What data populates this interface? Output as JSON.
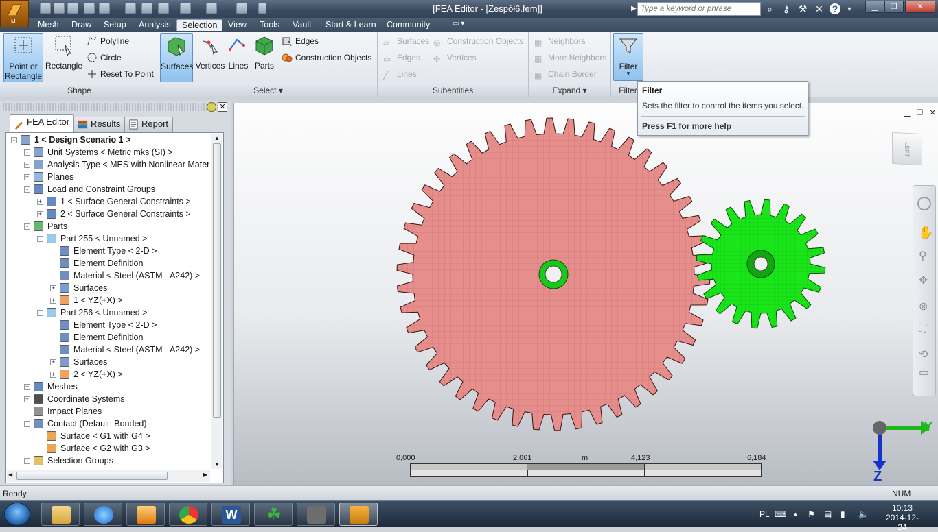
{
  "window": {
    "title": "[FEA Editor - [Zespół6.fem]]",
    "app_button_label": "M"
  },
  "search": {
    "placeholder": "Type a keyword or phrase"
  },
  "menu": [
    "Mesh",
    "Draw",
    "Setup",
    "Analysis",
    "Selection",
    "View",
    "Tools",
    "Vault",
    "Start & Learn",
    "Community"
  ],
  "menu_active": "Selection",
  "ribbon": {
    "shape": {
      "label": "Shape",
      "point_or_rectangle": "Point or Rectangle",
      "rectangle": "Rectangle",
      "polyline": "Polyline",
      "circle": "Circle",
      "reset_to_point": "Reset To Point"
    },
    "select": {
      "label": "Select",
      "surfaces": "Surfaces",
      "vertices": "Vertices",
      "lines": "Lines",
      "parts": "Parts",
      "edges": "Edges",
      "construction_objects": "Construction Objects"
    },
    "subentities": {
      "label": "Subentities",
      "surfaces": "Surfaces",
      "edges": "Edges",
      "lines": "Lines",
      "construction_objects": "Construction Objects",
      "vertices": "Vertices"
    },
    "expand": {
      "label": "Expand",
      "neighbors": "Neighbors",
      "more_neighbors": "More Neighbors",
      "chain_border": "Chain Border"
    },
    "filter": {
      "label": "Filter",
      "button": "Filter"
    }
  },
  "tooltip": {
    "title": "Filter",
    "body": "Sets the filter to control the items you select.",
    "help": "Press F1 for more help"
  },
  "panel_tabs": [
    "FEA Editor",
    "Results",
    "Report"
  ],
  "tree": [
    {
      "label": "1 < Design Scenario 1 >",
      "level": 0,
      "exp": "-",
      "bold": true,
      "icon": "scenario-icon"
    },
    {
      "label": "Unit Systems < Metric mks (SI) >",
      "level": 1,
      "exp": "+",
      "icon": "units-icon"
    },
    {
      "label": "Analysis Type < MES with Nonlinear Materia",
      "level": 1,
      "exp": "+",
      "icon": "analysis-icon"
    },
    {
      "label": "Planes",
      "level": 1,
      "exp": "+",
      "icon": "planes-icon"
    },
    {
      "label": "Load and Constraint Groups",
      "level": 1,
      "exp": "-",
      "icon": "constraint-group-icon"
    },
    {
      "label": "1 < Surface General Constraints >",
      "level": 2,
      "exp": "+",
      "icon": "constraint-icon"
    },
    {
      "label": "2 < Surface General Constraints >",
      "level": 2,
      "exp": "+",
      "icon": "constraint-icon"
    },
    {
      "label": "Parts",
      "level": 1,
      "exp": "-",
      "icon": "parts-icon"
    },
    {
      "label": "Part 255 < Unnamed >",
      "level": 2,
      "exp": "-",
      "icon": "part-icon"
    },
    {
      "label": "Element Type < 2-D >",
      "level": 3,
      "exp": "",
      "icon": "sheet-icon"
    },
    {
      "label": "Element Definition",
      "level": 3,
      "exp": "",
      "icon": "sheet-icon"
    },
    {
      "label": "Material < Steel (ASTM - A242) >",
      "level": 3,
      "exp": "",
      "icon": "sheet-icon"
    },
    {
      "label": "Surfaces",
      "level": 3,
      "exp": "+",
      "icon": "surfaces-icon"
    },
    {
      "label": "1 < YZ(+X) >",
      "level": 3,
      "exp": "+",
      "icon": "load-icon"
    },
    {
      "label": "Part 256 < Unnamed >",
      "level": 2,
      "exp": "-",
      "icon": "part-icon"
    },
    {
      "label": "Element Type < 2-D >",
      "level": 3,
      "exp": "",
      "icon": "sheet-icon"
    },
    {
      "label": "Element Definition",
      "level": 3,
      "exp": "",
      "icon": "sheet-icon"
    },
    {
      "label": "Material < Steel (ASTM - A242) >",
      "level": 3,
      "exp": "",
      "icon": "sheet-icon"
    },
    {
      "label": "Surfaces",
      "level": 3,
      "exp": "+",
      "icon": "surfaces-icon"
    },
    {
      "label": "2 < YZ(+X) >",
      "level": 3,
      "exp": "+",
      "icon": "load-icon"
    },
    {
      "label": "Meshes",
      "level": 1,
      "exp": "+",
      "icon": "mesh-icon"
    },
    {
      "label": "Coordinate Systems",
      "level": 1,
      "exp": "+",
      "icon": "coordinate-icon"
    },
    {
      "label": "Impact Planes",
      "level": 1,
      "exp": "",
      "icon": "impact-icon"
    },
    {
      "label": "Contact (Default: Bonded)",
      "level": 1,
      "exp": "-",
      "icon": "contact-icon"
    },
    {
      "label": "Surface < G1 with G4 >",
      "level": 2,
      "exp": "",
      "icon": "contact-pair-icon"
    },
    {
      "label": "Surface < G2 with G3 >",
      "level": 2,
      "exp": "",
      "icon": "contact-pair-icon"
    },
    {
      "label": "Selection Groups",
      "level": 1,
      "exp": "-",
      "icon": "folder-icon"
    }
  ],
  "viewport": {
    "viewcube_label": "LEFT",
    "axis_y": "Y",
    "axis_z": "Z",
    "scale": {
      "t0": "0,000",
      "t1": "2,061",
      "unit": "m",
      "t2": "4,123",
      "t3": "6,184"
    }
  },
  "status": {
    "left": "Ready",
    "right": "NUM"
  },
  "taskbar": {
    "lang": "PL",
    "time": "10:13",
    "date": "2014-12-24"
  },
  "colors": {
    "gear_large": "#e58e8c",
    "gear_small": "#19e619",
    "accent": "#f5c35a"
  }
}
